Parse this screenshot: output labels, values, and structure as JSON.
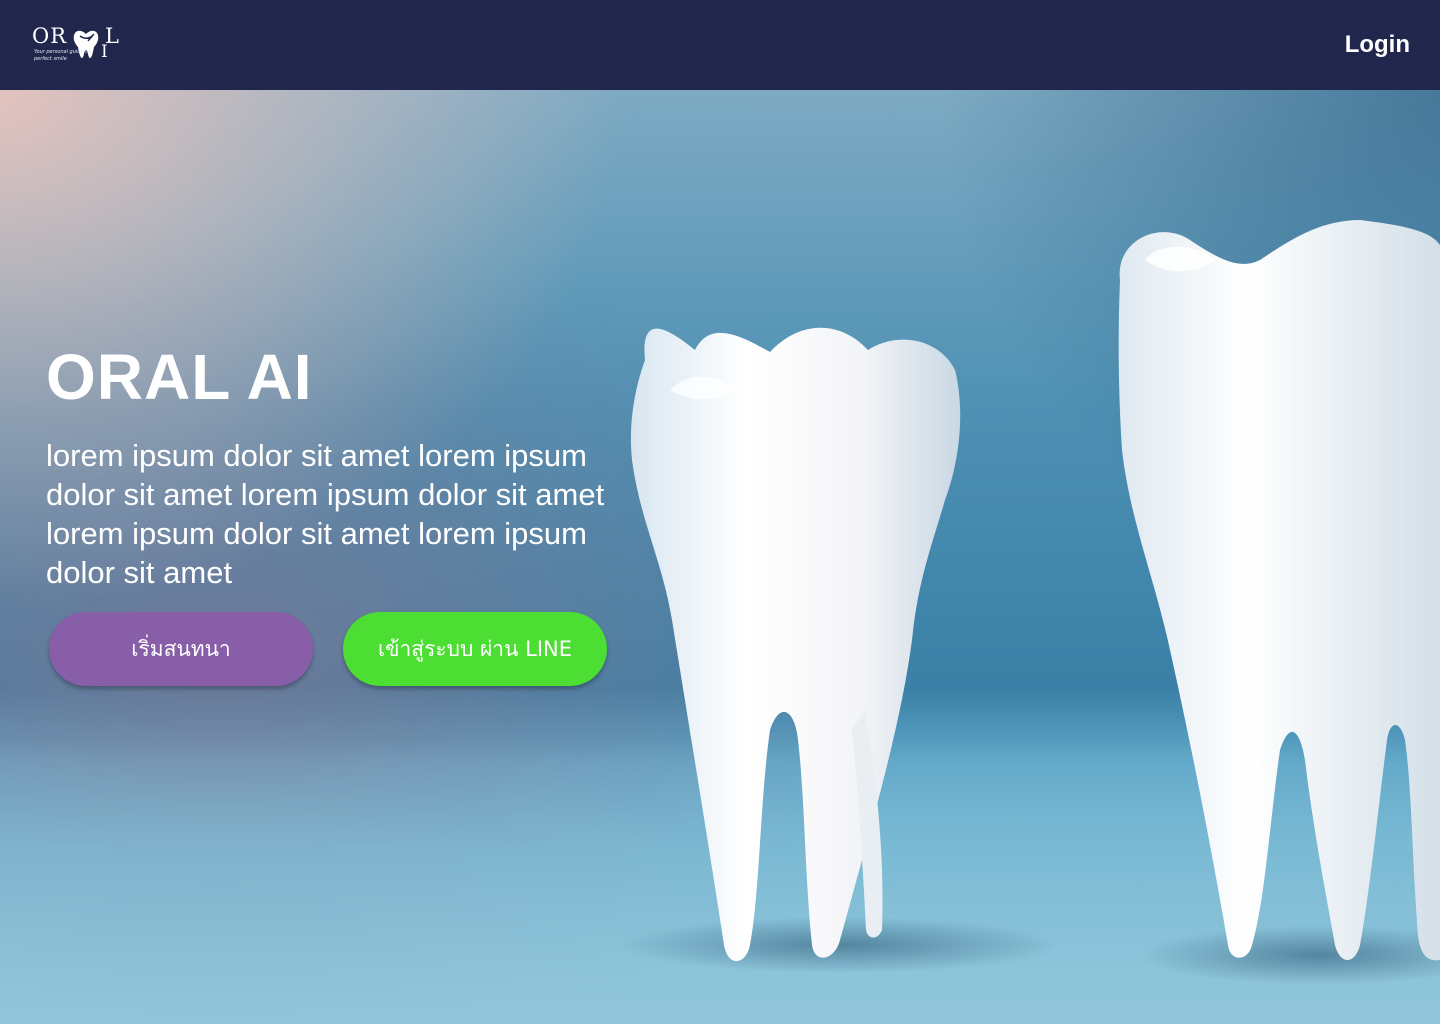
{
  "brand": {
    "logo_or": "OR",
    "logo_l": "L",
    "logo_i": "I",
    "logo_tagline": "Your personal guide to perfect smile",
    "nav_bg": "#20264c"
  },
  "nav": {
    "login_label": "Login"
  },
  "hero": {
    "title": "ORAL AI",
    "description": "lorem ipsum dolor sit amet lorem ipsum dolor sit amet lorem ipsum dolor sit amet lorem ipsum dolor sit amet lorem ipsum dolor sit amet",
    "start_chat_label": "เริ่มสนทนา",
    "line_login_label": "เข้าสู่ระบบ ผ่าน LINE",
    "start_chat_color": "#895ea8",
    "line_login_color": "#4dde33"
  }
}
